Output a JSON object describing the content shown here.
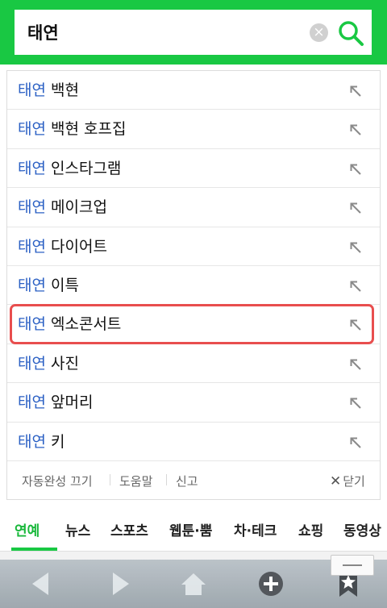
{
  "search": {
    "query": "태연",
    "clear_icon": "×"
  },
  "suggestions": [
    {
      "keyword": "태연",
      "rest": " 백현"
    },
    {
      "keyword": "태연",
      "rest": " 백현 호프집"
    },
    {
      "keyword": "태연",
      "rest": " 인스타그램"
    },
    {
      "keyword": "태연",
      "rest": " 메이크업"
    },
    {
      "keyword": "태연",
      "rest": " 다이어트"
    },
    {
      "keyword": "태연",
      "rest": " 이특"
    },
    {
      "keyword": "태연",
      "rest": " 엑소콘서트"
    },
    {
      "keyword": "태연",
      "rest": " 사진"
    },
    {
      "keyword": "태연",
      "rest": " 앞머리"
    },
    {
      "keyword": "태연",
      "rest": " 키"
    }
  ],
  "footer": {
    "autocomplete_off": "자동완성 끄기",
    "help": "도움말",
    "report": "신고",
    "close_icon": "✕",
    "close": "닫기"
  },
  "tabs": [
    "연예",
    "뉴스",
    "스포츠",
    "웹툰·뿜",
    "차·테크",
    "쇼핑",
    "동영상"
  ],
  "active_tab": "연예",
  "colors": {
    "brand_green": "#19c843",
    "keyword_blue": "#2b60c4",
    "highlight_red": "#e84e4e"
  },
  "icons": {
    "search": "search-icon",
    "clear": "clear-icon",
    "fill_arrow": "arrow-up-left-icon",
    "back": "back-arrow-icon",
    "forward": "forward-arrow-icon",
    "home": "home-icon",
    "add": "plus-circle-icon",
    "bookmark": "bookmark-star-icon"
  }
}
